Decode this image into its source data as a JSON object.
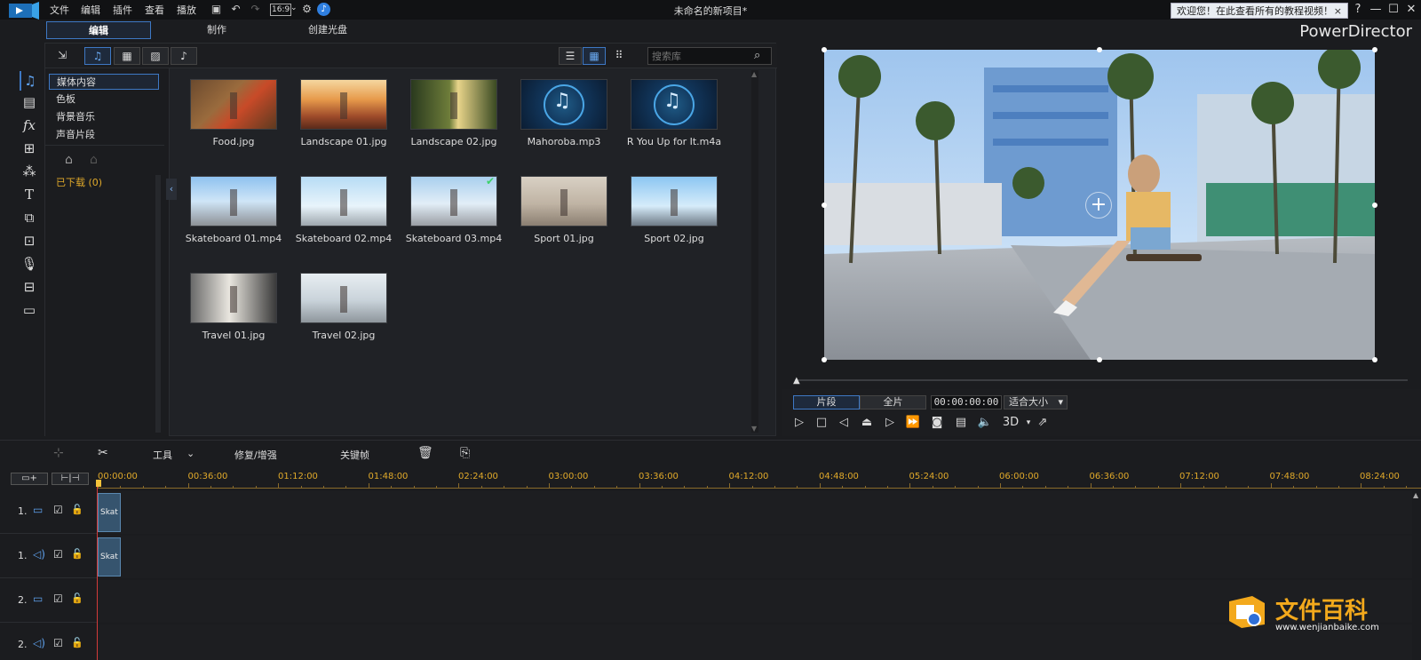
{
  "menu": [
    "文件",
    "编辑",
    "插件",
    "查看",
    "播放"
  ],
  "aspect_ratio": "16:9",
  "window_title": "未命名的新项目*",
  "tip": "欢迎您！在此查看所有的教程视频！",
  "tip_close": "×",
  "help": "?",
  "modes": [
    "编辑",
    "制作",
    "创建光盘"
  ],
  "brand": "PowerDirector",
  "search_placeholder": "搜索库",
  "tree": [
    "媒体内容",
    "色板",
    "背景音乐",
    "声音片段"
  ],
  "downloaded": "已下载  (0)",
  "media": [
    {
      "label": "Food.jpg",
      "kind": "image",
      "theme": "food"
    },
    {
      "label": "Landscape 01.jpg",
      "kind": "image",
      "theme": "canyon"
    },
    {
      "label": "Landscape 02.jpg",
      "kind": "image",
      "theme": "forest"
    },
    {
      "label": "Mahoroba.mp3",
      "kind": "audio"
    },
    {
      "label": "R You Up for It.m4a",
      "kind": "audio"
    },
    {
      "label": "Skateboard 01.mp4",
      "kind": "video",
      "theme": "street"
    },
    {
      "label": "Skateboard 02.mp4",
      "kind": "video",
      "theme": "sky"
    },
    {
      "label": "Skateboard 03.mp4",
      "kind": "video",
      "theme": "street2",
      "checked": true
    },
    {
      "label": "Sport 01.jpg",
      "kind": "image",
      "theme": "gym"
    },
    {
      "label": "Sport 02.jpg",
      "kind": "image",
      "theme": "bridge"
    },
    {
      "label": "Travel 01.jpg",
      "kind": "image",
      "theme": "train"
    },
    {
      "label": "Travel 02.jpg",
      "kind": "image",
      "theme": "airport"
    }
  ],
  "preview": {
    "seg_clip": "片段",
    "seg_full": "全片",
    "timecode": "00:00:00:00",
    "fit": "适合大小",
    "threed": "3D"
  },
  "timeline_tools": {
    "tools": "工具",
    "fix": "修复/增强",
    "keyframe": "关键帧"
  },
  "ruler": [
    "00:00:00",
    "00:36:00",
    "01:12:00",
    "01:48:00",
    "02:24:00",
    "03:00:00",
    "03:36:00",
    "04:12:00",
    "04:48:00",
    "05:24:00",
    "06:00:00",
    "06:36:00",
    "07:12:00",
    "07:48:00",
    "08:24:00"
  ],
  "tracks": [
    {
      "label": "1.",
      "type": "video"
    },
    {
      "label": "1.",
      "type": "audio"
    },
    {
      "label": "2.",
      "type": "video"
    },
    {
      "label": "2.",
      "type": "audio"
    }
  ],
  "clip_label": "Skat",
  "watermark": {
    "title": "文件百科",
    "url": "www.wenjianbaike.com"
  }
}
